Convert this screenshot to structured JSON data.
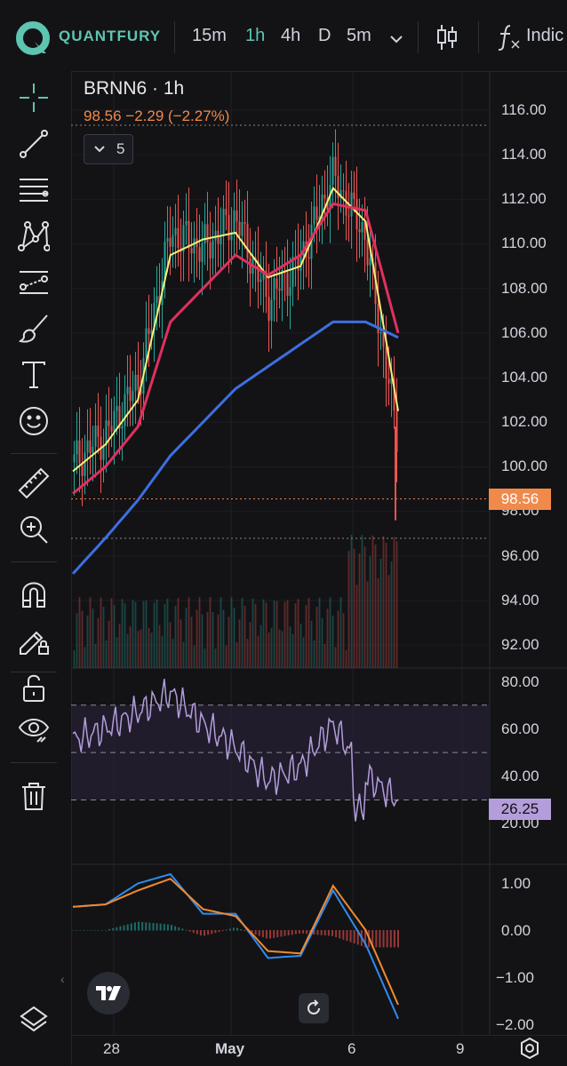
{
  "brand": {
    "name": "QUANTFURY",
    "accent": "#5ec5b1"
  },
  "timeframes": [
    {
      "label": "15m",
      "active": false
    },
    {
      "label": "1h",
      "active": true
    },
    {
      "label": "4h",
      "active": false
    },
    {
      "label": "D",
      "active": false
    },
    {
      "label": "5m",
      "active": false
    }
  ],
  "toolbar": {
    "indicators_label": "Indic"
  },
  "symbol": {
    "title": "BRNN6 · 1h",
    "quote": "98.56  −2.29  (−2.27%)",
    "indicator_count": "5"
  },
  "price_axis": [
    "116.00",
    "114.00",
    "112.00",
    "110.00",
    "108.00",
    "106.00",
    "104.00",
    "102.00",
    "100.00",
    "98.00",
    "96.00",
    "94.00",
    "92.00"
  ],
  "last_price_tag": "98.56",
  "rsi_axis": [
    "80.00",
    "60.00",
    "40.00",
    "20.00"
  ],
  "rsi_value_tag": "26.25",
  "macd_axis": [
    "1.00",
    "0.00",
    "−1.00",
    "−2.00"
  ],
  "time_axis": [
    "28",
    "May",
    "6",
    "9"
  ],
  "sidebar_tools": [
    "crosshair-icon",
    "trend-line-icon",
    "fib-retracement-icon",
    "pattern-icon",
    "prediction-icon",
    "brush-icon",
    "text-icon",
    "emoji-icon",
    "ruler-icon",
    "zoom-in-icon",
    "magnet-icon",
    "lock-drawings-icon",
    "unlock-icon",
    "eye-icon",
    "trash-icon"
  ],
  "colors": {
    "up": "#26a69a",
    "down": "#ef5350",
    "ema_fast": "#f6f07a",
    "ema_mid": "#e0305f",
    "ema_slow": "#3d6fe0",
    "rsi": "#b39ddb",
    "macd": "#2f8cf0",
    "signal": "#f08a2f",
    "price_line": "#f08a4b"
  },
  "chart_data": [
    {
      "type": "line",
      "symbol": "BRNN6",
      "timeframe": "1h",
      "x": [
        "Apr 27 12h",
        "Apr 28",
        "Apr 29",
        "Apr 30",
        "May 1",
        "May 2",
        "May 3",
        "May 4",
        "May 5",
        "May 6",
        "May 7"
      ],
      "series": [
        {
          "values": [
            100.2,
            101.5,
            103.8,
            110.5,
            109.8,
            111.2,
            107.5,
            109.2,
            113.0,
            110.5,
            101.5
          ]
        },
        {
          "values": [
            99.8,
            101.0,
            103.0,
            109.5,
            110.2,
            110.5,
            108.5,
            109.0,
            112.5,
            111.0,
            102.5
          ]
        },
        {
          "values": [
            98.8,
            100.0,
            101.8,
            106.5,
            108.0,
            109.5,
            108.6,
            109.5,
            111.8,
            111.5,
            106.0
          ]
        },
        {
          "values": [
            95.2,
            96.8,
            98.5,
            100.5,
            102.0,
            103.5,
            104.5,
            105.5,
            106.5,
            106.5,
            105.8
          ]
        }
      ],
      "last": 98.56,
      "ylim": [
        90.9,
        117.4
      ]
    },
    {
      "type": "line",
      "x": [
        "Apr 27 12h",
        "Apr 28",
        "Apr 29",
        "Apr 30",
        "May 1",
        "May 2",
        "May 3",
        "May 4",
        "May 5",
        "May 6",
        "May 7"
      ],
      "series": [
        {
          "values": [
            55,
            60,
            67,
            75,
            62,
            52,
            38,
            44,
            62,
            40,
            30
          ]
        }
      ],
      "levels": [
        70,
        50,
        30
      ],
      "last": 26.25,
      "ylim": [
        13,
        82
      ]
    },
    {
      "type": "line",
      "x": [
        "Apr 27 12h",
        "Apr 28",
        "Apr 29",
        "Apr 30",
        "May 1",
        "May 2",
        "May 3",
        "May 4",
        "May 5",
        "May 6",
        "May 7"
      ],
      "series": [
        {
          "values": [
            0.5,
            0.55,
            1.0,
            1.2,
            0.35,
            0.35,
            -0.6,
            -0.55,
            0.85,
            -0.3,
            -1.9
          ]
        },
        {
          "values": [
            0.5,
            0.55,
            0.85,
            1.1,
            0.45,
            0.3,
            -0.45,
            -0.5,
            0.95,
            0.0,
            -1.6
          ]
        }
      ],
      "ylim": [
        -2.2,
        1.3
      ]
    }
  ]
}
